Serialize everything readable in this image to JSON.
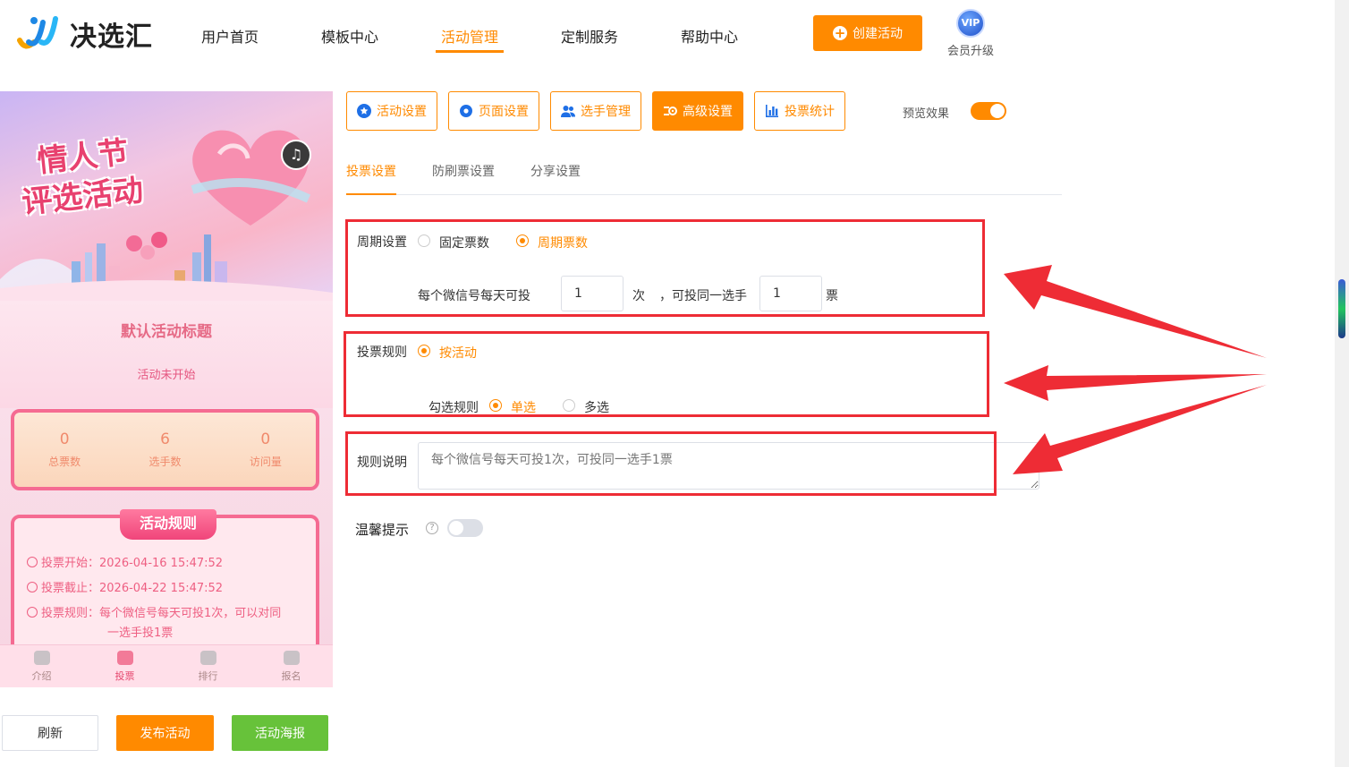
{
  "header": {
    "brand": "决选汇",
    "nav": [
      "用户首页",
      "模板中心",
      "活动管理",
      "定制服务",
      "帮助中心"
    ],
    "create_button": "创建活动",
    "vip_badge": "VIP",
    "vip_label": "会员升级",
    "accent": "#ff8a00"
  },
  "preview": {
    "banner_title_line1": "情人节",
    "banner_title_line2": "评选活动",
    "activity_title": "默认活动标题",
    "activity_status": "活动未开始",
    "stats": [
      {
        "value": "0",
        "label": "总票数"
      },
      {
        "value": "6",
        "label": "选手数"
      },
      {
        "value": "0",
        "label": "访问量"
      }
    ],
    "rules_title": "活动规则",
    "rules": [
      "投票开始：2026-04-16 15:47:52",
      "投票截止：2026-04-22 15:47:52",
      "投票规则：每个微信号每天可投1次，可以对同",
      "一选手投1票"
    ],
    "tabs": [
      "介绍",
      "投票",
      "排行",
      "报名"
    ]
  },
  "bottom_buttons": {
    "refresh": "刷新",
    "publish": "发布活动",
    "poster": "活动海报"
  },
  "toolbar": {
    "buttons": [
      "活动设置",
      "页面设置",
      "选手管理",
      "高级设置",
      "投票统计"
    ],
    "preview_label": "预览效果",
    "preview_on": true
  },
  "subtabs": [
    "投票设置",
    "防刷票设置",
    "分享设置"
  ],
  "form": {
    "cycle_label": "周期设置",
    "cycle_options": [
      "固定票数",
      "周期票数"
    ],
    "cycle_selected": "周期票数",
    "per_day_prefix": "每个微信号每天可投",
    "per_day_value": "1",
    "per_day_unit": "次",
    "same_player_prefix": "，可投同一选手",
    "same_player_value": "1",
    "same_player_unit": "票",
    "vote_rule_label": "投票规则",
    "vote_rule_option": "按活动",
    "check_rule_label": "勾选规则",
    "check_options": [
      "单选",
      "多选"
    ],
    "check_selected": "单选",
    "rule_desc_label": "规则说明",
    "rule_desc_placeholder": "每个微信号每天可投1次，可投同一选手1票",
    "tips_label": "温馨提示",
    "tips_on": false
  }
}
